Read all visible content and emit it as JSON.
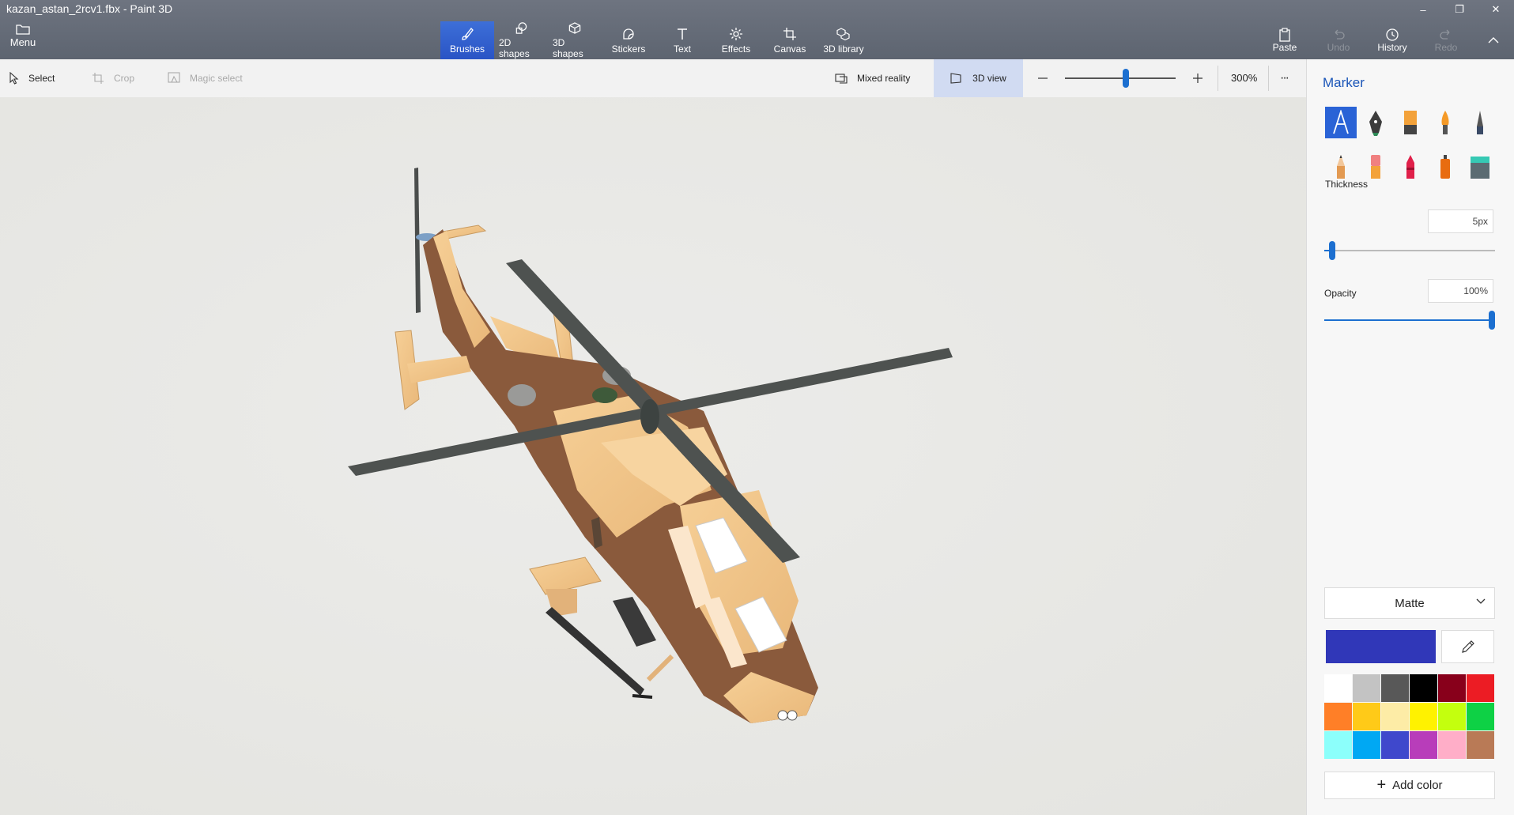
{
  "window": {
    "title": "kazan_astan_2rcv1.fbx - Paint 3D",
    "minimize": "–",
    "restore": "❐",
    "close": "✕"
  },
  "menu": {
    "label": "Menu"
  },
  "tools": [
    {
      "label": "Brushes",
      "icon": "brush-icon",
      "active": true
    },
    {
      "label": "2D shapes",
      "icon": "2d-shapes-icon"
    },
    {
      "label": "3D shapes",
      "icon": "3d-shapes-icon"
    },
    {
      "label": "Stickers",
      "icon": "stickers-icon"
    },
    {
      "label": "Text",
      "icon": "text-icon"
    },
    {
      "label": "Effects",
      "icon": "effects-icon"
    },
    {
      "label": "Canvas",
      "icon": "canvas-icon"
    },
    {
      "label": "3D library",
      "icon": "3d-library-icon"
    }
  ],
  "right_tools": {
    "paste": "Paste",
    "undo": "Undo",
    "redo": "Redo",
    "history": "History"
  },
  "subbar": {
    "select": "Select",
    "crop": "Crop",
    "magic_select": "Magic select",
    "mixed_reality": "Mixed reality",
    "view_3d": "3D view",
    "zoom_value": "300%",
    "zoom_level": 0.55,
    "more": "···"
  },
  "panel": {
    "title": "Marker",
    "brushes": [
      "marker-icon",
      "calligraphy-pen-icon",
      "oil-brush-icon",
      "watercolor-icon",
      "pixel-pen-icon",
      "pencil-icon",
      "eraser-icon",
      "crayon-icon",
      "spray-can-icon",
      "fill-icon"
    ],
    "thickness_label": "Thickness",
    "thickness_value": "5px",
    "thickness_level": 0.03,
    "opacity_label": "Opacity",
    "opacity_value": "100%",
    "opacity_level": 1.0,
    "finish": "Matte",
    "current_color": "#3037b8",
    "palette": [
      "#ffffff",
      "#c3c3c3",
      "#585858",
      "#000000",
      "#88001b",
      "#ec1c24",
      "#ff7f27",
      "#ffca18",
      "#fdeca6",
      "#fff200",
      "#c4ff0e",
      "#0ed145",
      "#8cfffb",
      "#00a8f3",
      "#3f48cc",
      "#b83dba",
      "#ffaec8",
      "#b97a56"
    ],
    "add_color": "Add color"
  }
}
